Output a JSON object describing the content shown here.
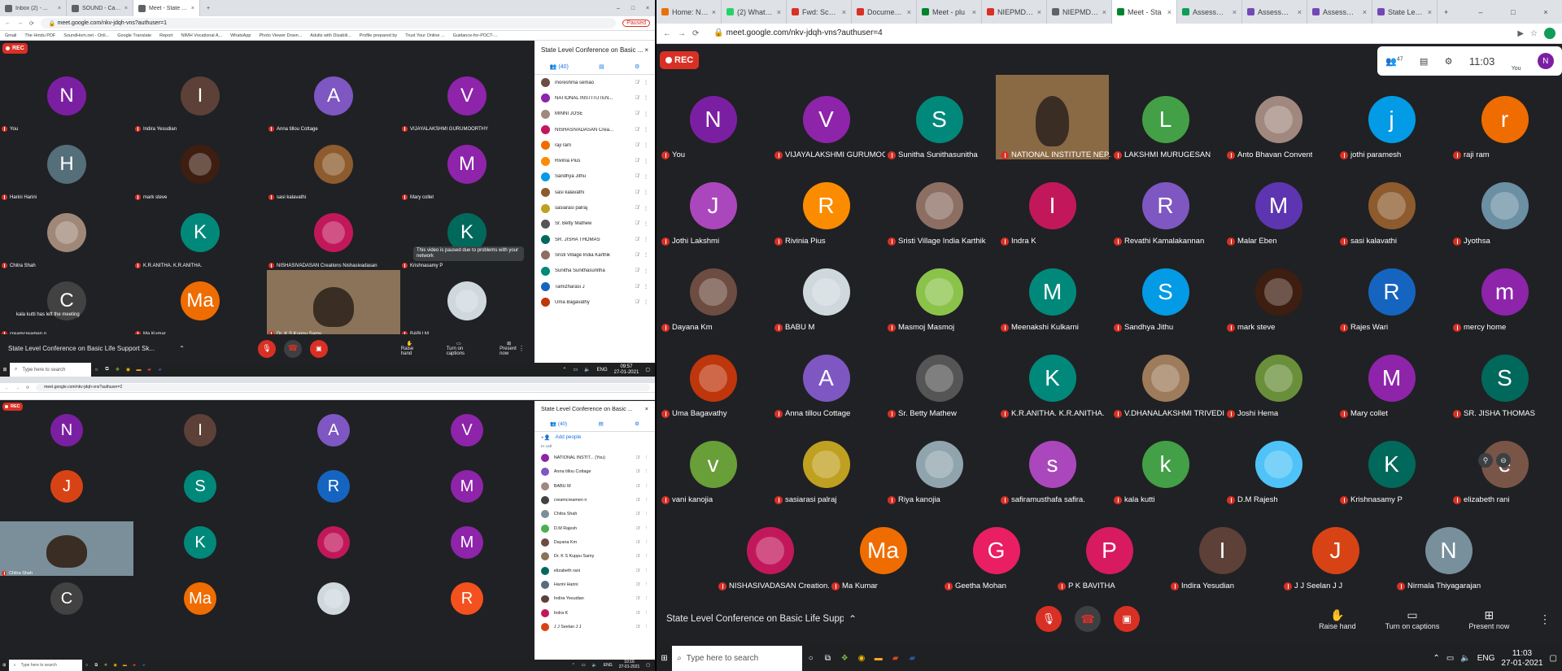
{
  "left_top": {
    "tabs": [
      {
        "label": "Inbox (2) - ..."
      },
      {
        "label": "SOUND - Calendar - Wednesd..."
      },
      {
        "label": "Meet - State Level Confer..."
      }
    ],
    "url": "meet.google.com/nkv-jdqh-vns?authuser=1",
    "bookmarks": [
      "Gmail",
      "The Hindu PDF",
      "SoundHom.net - Onli...",
      "Google Translate",
      "Report",
      "NIMH Vocational A...",
      "WhatsApp",
      "Photo Viewer Down...",
      "Adults with Disabili...",
      "Profile prepared by",
      "Trust Your Online ...",
      "Guidance-for-POCT-..."
    ],
    "paused_label": "Paused",
    "rec": "REC",
    "tiles": [
      {
        "letter": "N",
        "name": "You",
        "color": "#7b1fa2"
      },
      {
        "letter": "I",
        "name": "Indira Yesudian",
        "color": "#5d4037"
      },
      {
        "letter": "A",
        "name": "Anna tillou Cottage",
        "color": "#7e57c2"
      },
      {
        "letter": "V",
        "name": "VIJAYALAKSHMI GURUMOORTHY",
        "color": "#8e24aa"
      },
      {
        "letter": "H",
        "name": "Harini Harini",
        "color": "#546e7a"
      },
      {
        "letter": "",
        "name": "mark steve",
        "color": "#3e1e10"
      },
      {
        "letter": "",
        "name": "sasi kalavathi",
        "color": "#8d5b2e"
      },
      {
        "letter": "M",
        "name": "Mary collet",
        "color": "#8e24aa"
      },
      {
        "letter": "",
        "name": "Chitra Shah",
        "color": "#a08878"
      },
      {
        "letter": "K",
        "name": "K.R.ANITHA. K.R.ANITHA.",
        "color": "#00897b"
      },
      {
        "letter": "",
        "name": "NISHASIVADASAN Creations Nishasivadasan",
        "color": "#c2185b"
      },
      {
        "letter": "K",
        "name": "Krishnasamy P",
        "color": "#00695c"
      },
      {
        "letter": "C",
        "name": "creamcreamen n",
        "color": "#424242"
      },
      {
        "letter": "Ma",
        "name": "Ma Kumar",
        "color": "#ef6c00"
      },
      {
        "letter": "",
        "name": "Dr. K S Kuppu Samy",
        "color": "#8a7358"
      },
      {
        "letter": "",
        "name": "BABU M",
        "color": "#cfd8dc"
      }
    ],
    "tooltip": "This video is paused due to problems with your network",
    "toast": "kala kutti has left the meeting",
    "meeting_title": "State Level Conference on Basic Life Support Sk...",
    "actions": [
      "Raise hand",
      "Turn on captions",
      "Present now"
    ],
    "panel": {
      "title": "State Level Conference on Basic ...",
      "count": "(40)",
      "people": [
        {
          "name": "moreshma semao",
          "color": "#6d4c41"
        },
        {
          "name": "NATIONAL INSTITUTEN...",
          "color": "#8e24aa"
        },
        {
          "name": "MINNI JOSE",
          "color": "#a1887f"
        },
        {
          "name": "NISHASIVADASAN Crea...",
          "color": "#c2185b"
        },
        {
          "name": "raji ram",
          "color": "#ef6c00"
        },
        {
          "name": "Rivinia Pius",
          "color": "#fb8c00"
        },
        {
          "name": "Sandhya Jithu",
          "color": "#039be5"
        },
        {
          "name": "sasi kalavathi",
          "color": "#8d5b2e"
        },
        {
          "name": "sasiarasi palraj",
          "color": "#c0a020"
        },
        {
          "name": "Sr. Betty Mathew",
          "color": "#555555"
        },
        {
          "name": "SR. JISHA THOMAS",
          "color": "#00695c"
        },
        {
          "name": "Sristi Village India Karthik",
          "color": "#8d6e63"
        },
        {
          "name": "Sunitha Sunithasunitha",
          "color": "#00897b"
        },
        {
          "name": "Tamizharasi J",
          "color": "#1565c0"
        },
        {
          "name": "Uma Bagavathy",
          "color": "#bf360c"
        }
      ]
    },
    "taskbar": {
      "search": "Type here to search",
      "lang": "ENG",
      "time": "09:57",
      "date": "27-01-2021"
    }
  },
  "left_bottom": {
    "url": "meet.google.com/nkv-jdqh-vns?authuser=2",
    "rec": "REC",
    "tiles": [
      {
        "letter": "N",
        "name": "",
        "color": "#7b1fa2"
      },
      {
        "letter": "I",
        "name": "",
        "color": "#5d4037"
      },
      {
        "letter": "A",
        "name": "",
        "color": "#7e57c2"
      },
      {
        "letter": "V",
        "name": "",
        "color": "#8e24aa"
      },
      {
        "letter": "J",
        "name": "",
        "color": "#d84315"
      },
      {
        "letter": "S",
        "name": "",
        "color": "#00897b"
      },
      {
        "letter": "R",
        "name": "",
        "color": "#1565c0"
      },
      {
        "letter": "M",
        "name": "",
        "color": "#8e24aa"
      },
      {
        "letter": "",
        "name": "Chitra Shah",
        "color": "#7a8f9a"
      },
      {
        "letter": "K",
        "name": "",
        "color": "#00897b"
      },
      {
        "letter": "",
        "name": "",
        "color": "#c2185b"
      },
      {
        "letter": "M",
        "name": "",
        "color": "#8e24aa"
      },
      {
        "letter": "C",
        "name": "",
        "color": "#424242"
      },
      {
        "letter": "Ma",
        "name": "",
        "color": "#ef6c00"
      },
      {
        "letter": "",
        "name": "",
        "color": "#cfd8dc"
      },
      {
        "letter": "R",
        "name": "",
        "color": "#f4511e"
      }
    ],
    "panel": {
      "title": "State Level Conference on Basic ...",
      "count": "(40)",
      "add_people": "Add people",
      "section": "In call",
      "people": [
        {
          "name": "NATIONAL INSTIT... (You)",
          "color": "#8e24aa"
        },
        {
          "name": "Anna tillou Cottage",
          "color": "#7e57c2"
        },
        {
          "name": "BABU M",
          "color": "#a1887f"
        },
        {
          "name": "creamcreamen n",
          "color": "#424242"
        },
        {
          "name": "Chitra Shah",
          "color": "#7a8f9a"
        },
        {
          "name": "D.M Rajesh",
          "color": "#4caf50"
        },
        {
          "name": "Dayana Km",
          "color": "#6d4c41"
        },
        {
          "name": "Dr. K S Kuppu Samy",
          "color": "#8a7358"
        },
        {
          "name": "elizabeth rani",
          "color": "#00695c"
        },
        {
          "name": "Harini Harini",
          "color": "#546e7a"
        },
        {
          "name": "Indira Yesudian",
          "color": "#5d4037"
        },
        {
          "name": "Indra K",
          "color": "#c2185b"
        },
        {
          "name": "J J Seelan J J",
          "color": "#d84315"
        }
      ]
    },
    "taskbar": {
      "search": "Type here to search",
      "lang": "ENG",
      "time": "10:16",
      "date": "27-01-2021"
    }
  },
  "right": {
    "tabs": [
      {
        "label": "Home: NIEPMD",
        "color": "#e8710a"
      },
      {
        "label": "(2) WhatsApp",
        "color": "#25d366"
      },
      {
        "label": "Fwd: Schedule",
        "color": "#d93025"
      },
      {
        "label": "Document fro",
        "color": "#d93025"
      },
      {
        "label": "Meet - plu",
        "color": "#00832d"
      },
      {
        "label": "NIEPMD Mail",
        "color": "#d93025"
      },
      {
        "label": "NIEPMD - Cale",
        "color": "#5f6368"
      },
      {
        "label": "Meet - Sta",
        "color": "#00832d"
      },
      {
        "label": "Assessment o",
        "color": "#0f9d58"
      },
      {
        "label": "Assessment 1",
        "color": "#7248b9"
      },
      {
        "label": "Assessment 1",
        "color": "#7248b9"
      },
      {
        "label": "State Level Co",
        "color": "#7248b9"
      }
    ],
    "url": "meet.google.com/nkv-jdqh-vns?authuser=4",
    "rec": "REC",
    "participants_count": "47",
    "clock": "11:03",
    "you_label": "You",
    "you_letter": "N",
    "tiles": [
      {
        "letter": "N",
        "name": "You",
        "color": "#7b1fa2"
      },
      {
        "letter": "V",
        "name": "VIJAYALAKSHMI GURUMOO...",
        "color": "#8e24aa"
      },
      {
        "letter": "S",
        "name": "Sunitha Sunithasunitha",
        "color": "#00897b"
      },
      {
        "letter": "",
        "name": "NATIONAL INSTITUTE NEP...",
        "color": "#8a6a45"
      },
      {
        "letter": "L",
        "name": "LAKSHMI MURUGESAN",
        "color": "#43a047"
      },
      {
        "letter": "",
        "name": "Anto Bhavan Convent",
        "color": "#a1887f"
      },
      {
        "letter": "j",
        "name": "jothi paramesh",
        "color": "#039be5"
      },
      {
        "letter": "r",
        "name": "raji ram",
        "color": "#ef6c00"
      },
      {
        "letter": "J",
        "name": "Jothi Lakshmi",
        "color": "#ab47bc"
      },
      {
        "letter": "R",
        "name": "Rivinia Pius",
        "color": "#fb8c00"
      },
      {
        "letter": "",
        "name": "Sristi Village India Karthik",
        "color": "#8d6e63"
      },
      {
        "letter": "I",
        "name": "Indra K",
        "color": "#c2185b"
      },
      {
        "letter": "R",
        "name": "Revathi Kamalakannan",
        "color": "#7e57c2"
      },
      {
        "letter": "M",
        "name": "Malar Eben",
        "color": "#5e35b1"
      },
      {
        "letter": "",
        "name": "sasi kalavathi",
        "color": "#8d5b2e"
      },
      {
        "letter": "",
        "name": "Jyothsa",
        "color": "#6b8fa3"
      },
      {
        "letter": "",
        "name": "Dayana Km",
        "color": "#6d4c41"
      },
      {
        "letter": "",
        "name": "BABU M",
        "color": "#cfd8dc"
      },
      {
        "letter": "",
        "name": "Masmoj Masmoj",
        "color": "#8bc34a"
      },
      {
        "letter": "M",
        "name": "Meenakshi Kulkarni",
        "color": "#00897b"
      },
      {
        "letter": "S",
        "name": "Sandhya Jithu",
        "color": "#039be5"
      },
      {
        "letter": "",
        "name": "mark steve",
        "color": "#3e1e10"
      },
      {
        "letter": "R",
        "name": "Rajes Wari",
        "color": "#1565c0"
      },
      {
        "letter": "m",
        "name": "mercy home",
        "color": "#8e24aa"
      },
      {
        "letter": "",
        "name": "Uma Bagavathy",
        "color": "#bf360c"
      },
      {
        "letter": "A",
        "name": "Anna tillou Cottage",
        "color": "#7e57c2"
      },
      {
        "letter": "",
        "name": "Sr. Betty Mathew",
        "color": "#555555"
      },
      {
        "letter": "K",
        "name": "K.R.ANITHA. K.R.ANITHA.",
        "color": "#00897b"
      },
      {
        "letter": "",
        "name": "V.DHANALAKSHMI TRIVEDI",
        "color": "#9e7b5a"
      },
      {
        "letter": "",
        "name": "Joshi Hema",
        "color": "#6a8f3a"
      },
      {
        "letter": "M",
        "name": "Mary collet",
        "color": "#8e24aa"
      },
      {
        "letter": "S",
        "name": "SR. JISHA THOMAS",
        "color": "#00695c"
      },
      {
        "letter": "v",
        "name": "vani kanojia",
        "color": "#689f38"
      },
      {
        "letter": "",
        "name": "sasiarasi palraj",
        "color": "#c0a020"
      },
      {
        "letter": "",
        "name": "Riya kanojia",
        "color": "#90a4ae"
      },
      {
        "letter": "s",
        "name": "safiramusthafa safira.",
        "color": "#ab47bc"
      },
      {
        "letter": "k",
        "name": "kala kutti",
        "color": "#43a047"
      },
      {
        "letter": "",
        "name": "D.M Rajesh",
        "color": "#4fc3f7"
      },
      {
        "letter": "K",
        "name": "Krishnasamy P",
        "color": "#00695c"
      },
      {
        "letter": "e",
        "name": "elizabeth rani",
        "color": "#795548"
      },
      {
        "letter": "",
        "name": "NISHASIVADASAN Creation...",
        "color": "#c2185b"
      },
      {
        "letter": "Ma",
        "name": "Ma Kumar",
        "color": "#ef6c00"
      },
      {
        "letter": "G",
        "name": "Geetha Mohan",
        "color": "#e91e63"
      },
      {
        "letter": "P",
        "name": "P K BAVITHA",
        "color": "#d81b60"
      },
      {
        "letter": "I",
        "name": "Indira Yesudian",
        "color": "#5d4037"
      },
      {
        "letter": "J",
        "name": "J J Seelan J J",
        "color": "#d84315"
      },
      {
        "letter": "N",
        "name": "Nirmala Thiyagarajan",
        "color": "#78909c"
      }
    ],
    "meeting_title": "State Level Conference on Basic Life Support Sk...",
    "actions": [
      "Raise hand",
      "Turn on captions",
      "Present now"
    ],
    "taskbar": {
      "search": "Type here to search",
      "lang": "ENG",
      "time": "11:03",
      "date": "27-01-2021"
    }
  }
}
